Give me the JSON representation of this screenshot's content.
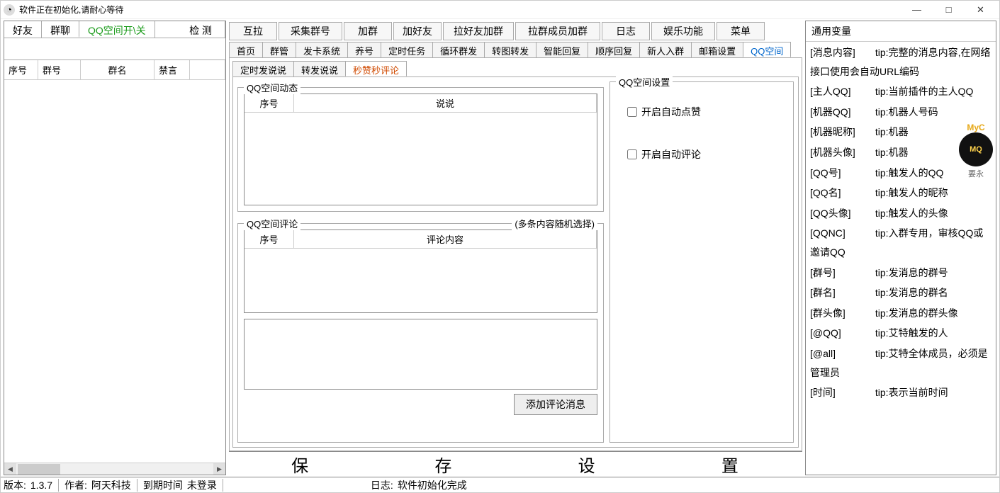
{
  "window": {
    "title": "软件正在初始化,请耐心等待",
    "minimize": "—",
    "maximize": "□",
    "close": "✕"
  },
  "leftTabs": [
    "好友",
    "群聊",
    "QQ空间开\\关",
    "检 测"
  ],
  "leftTable": {
    "cols": [
      "序号",
      "群号",
      "群名",
      "禁言",
      ""
    ]
  },
  "toolbar": [
    "互拉",
    "采集群号",
    "加群",
    "加好友",
    "拉好友加群",
    "拉群成员加群",
    "日志",
    "娱乐功能",
    "菜单"
  ],
  "navTabs": [
    "首页",
    "群管",
    "发卡系统",
    "养号",
    "定时任务",
    "循环群发",
    "转图转发",
    "智能回复",
    "顺序回复",
    "新人入群",
    "邮箱设置",
    "QQ空间"
  ],
  "subTabs": [
    "定时发说说",
    "转发说说",
    "秒赞秒评论"
  ],
  "groupDyn": {
    "title": "QQ空间动态",
    "cols": [
      "序号",
      "说说"
    ]
  },
  "groupCmt": {
    "title": "QQ空间评论",
    "note": "(多条内容随机选择)",
    "cols": [
      "序号",
      "评论内容"
    ],
    "addBtn": "添加评论消息"
  },
  "settings": {
    "title": "QQ空间设置",
    "chk1": "开启自动点赞",
    "chk2": "开启自动评论"
  },
  "rightPanel": {
    "title": "通用变量",
    "items": [
      {
        "k": "[消息内容]",
        "t": "tip:完整的消息内容,在网络接口使用会自动URL编码"
      },
      {
        "k": "[主人QQ]",
        "t": "tip:当前插件的主人QQ"
      },
      {
        "k": "[机器QQ]",
        "t": "tip:机器人号码"
      },
      {
        "k": "[机器昵称]",
        "t": "tip:机器"
      },
      {
        "k": "[机器头像]",
        "t": "tip:机器"
      },
      {
        "k": "[QQ号]",
        "t": "tip:触发人的QQ"
      },
      {
        "k": "[QQ名]",
        "t": "tip:触发人的昵称"
      },
      {
        "k": "[QQ头像]",
        "t": "tip:触发人的头像"
      },
      {
        "k": "[QQNC]",
        "t": "tip:入群专用，审核QQ或邀请QQ"
      },
      {
        "k": "[群号]",
        "t": "tip:发消息的群号"
      },
      {
        "k": "[群名]",
        "t": "tip:发消息的群名"
      },
      {
        "k": "[群头像]",
        "t": "tip:发消息的群头像"
      },
      {
        "k": "[@QQ]",
        "t": "tip:艾特触发的人"
      },
      {
        "k": "[@all]",
        "t": "tip:艾特全体成员，必须是管理员"
      },
      {
        "k": "[时间]",
        "t": "tip:表示当前时间"
      }
    ]
  },
  "saveBtn": [
    "保",
    "存",
    "设",
    "置"
  ],
  "status": {
    "verLabel": "版本:",
    "ver": "1.3.7",
    "authLabel": "作者:",
    "auth": "阿天科技",
    "expLabel": "到期时间",
    "exp": "未登录",
    "logLabel": "日志:",
    "log": "软件初始化完成"
  },
  "badge": {
    "l1": "MyC",
    "l2": "要永",
    "mq": "MQ"
  }
}
